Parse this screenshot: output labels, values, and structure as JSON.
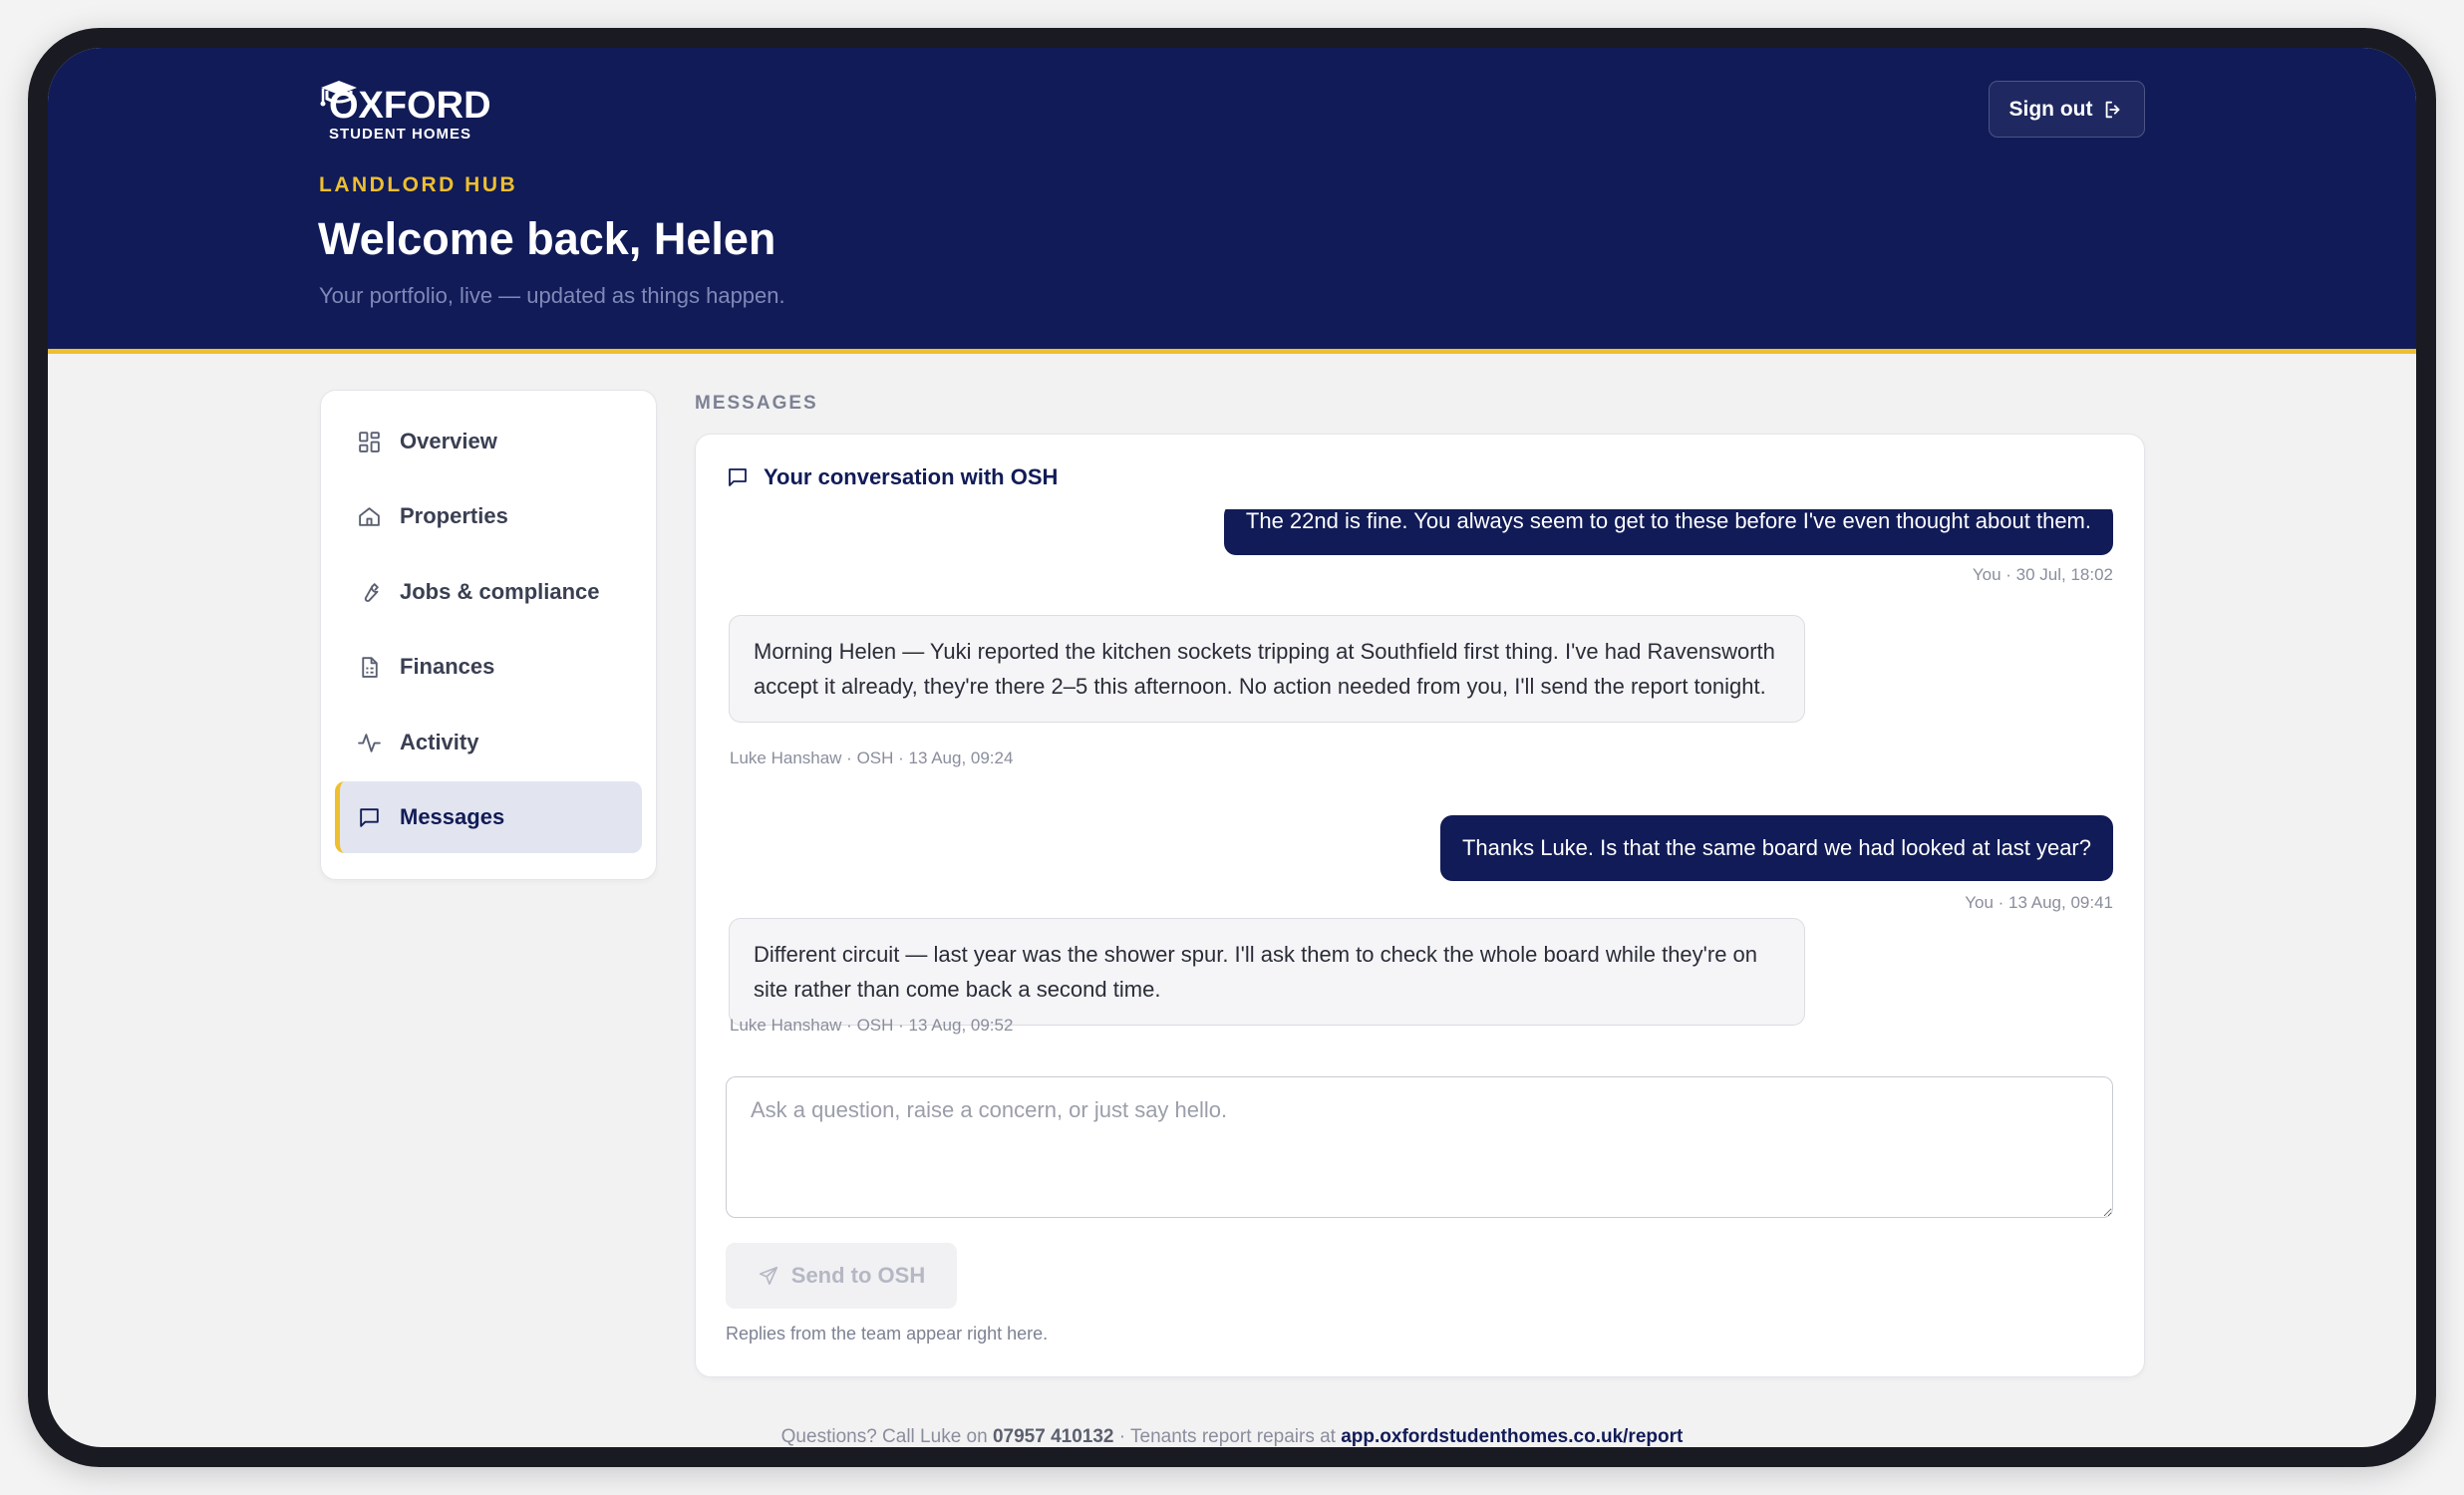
{
  "header": {
    "logo_word": "OXFORD",
    "logo_sub": "STUDENT HOMES",
    "hub_label": "LANDLORD HUB",
    "welcome": "Welcome back, Helen",
    "subtitle": "Your portfolio, live — updated as things happen.",
    "signout_label": "Sign out"
  },
  "sidebar": {
    "items": [
      {
        "label": "Overview",
        "icon": "grid-icon"
      },
      {
        "label": "Properties",
        "icon": "home-icon"
      },
      {
        "label": "Jobs & compliance",
        "icon": "wrench-icon"
      },
      {
        "label": "Finances",
        "icon": "document-icon"
      },
      {
        "label": "Activity",
        "icon": "activity-icon"
      },
      {
        "label": "Messages",
        "icon": "chat-icon",
        "active": true
      }
    ]
  },
  "main": {
    "section_label": "MESSAGES",
    "panel_title": "Your conversation with OSH",
    "messages": [
      {
        "direction": "out",
        "text": "The 22nd is fine. You always seem to get to these before I've even thought about them.",
        "meta": "You · 30 Jul, 18:02"
      },
      {
        "direction": "in",
        "text": "Morning Helen — Yuki reported the kitchen sockets tripping at Southfield first thing. I've had Ravensworth accept it already, they're there 2–5 this afternoon. No action needed from you, I'll send the report tonight.",
        "meta": "Luke Hanshaw · OSH · 13 Aug, 09:24"
      },
      {
        "direction": "out",
        "text": "Thanks Luke. Is that the same board we had looked at last year?",
        "meta": "You · 13 Aug, 09:41"
      },
      {
        "direction": "in",
        "text": "Different circuit — last year was the shower spur. I'll ask them to check the whole board while they're on site rather than come back a second time.",
        "meta": "Luke Hanshaw · OSH · 13 Aug, 09:52"
      }
    ],
    "composer_placeholder": "Ask a question, raise a concern, or just say hello.",
    "send_label": "Send to OSH",
    "hint": "Replies from the team appear right here."
  },
  "footer": {
    "prefix": "Questions? Call Luke on ",
    "phone": "07957 410132",
    "middle": " · Tenants report repairs at ",
    "link": "app.oxfordstudenthomes.co.uk/report"
  },
  "colors": {
    "navy": "#111b57",
    "accent": "#eebf2f"
  }
}
